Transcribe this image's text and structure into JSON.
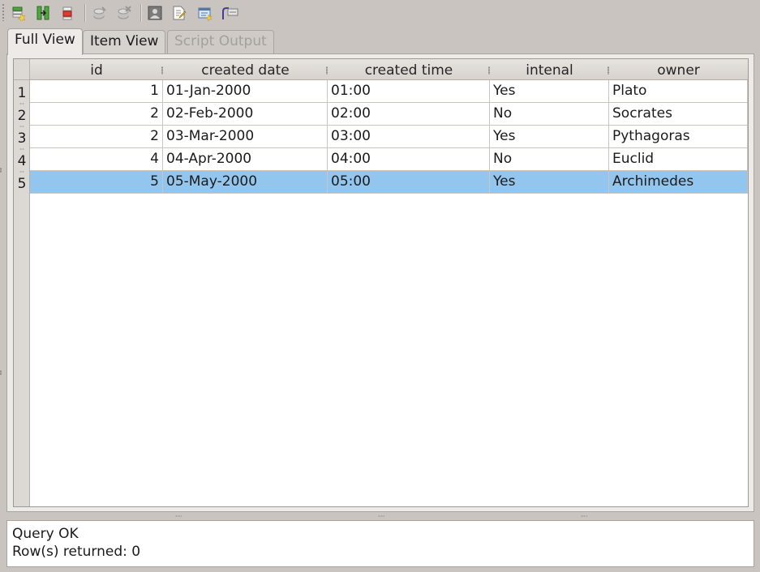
{
  "toolbar": {
    "items": [
      {
        "icon": "new-row-icon"
      },
      {
        "icon": "copy-row-icon"
      },
      {
        "icon": "delete-row-icon"
      },
      {
        "icon": "commit-icon"
      },
      {
        "icon": "rollback-icon"
      },
      {
        "icon": "image-icon"
      },
      {
        "icon": "export-icon"
      },
      {
        "icon": "sql-icon"
      },
      {
        "icon": "filter-icon"
      }
    ]
  },
  "tabs": [
    {
      "label": "Full View",
      "state": "active"
    },
    {
      "label": "Item View",
      "state": "normal"
    },
    {
      "label": "Script Output",
      "state": "disabled"
    }
  ],
  "table": {
    "columns": [
      "id",
      "created date",
      "created time",
      "intenal",
      "owner"
    ],
    "rows": [
      {
        "num": "1",
        "cells": [
          "1",
          "01-Jan-2000",
          "01:00",
          "Yes",
          "Plato"
        ]
      },
      {
        "num": "2",
        "cells": [
          "2",
          "02-Feb-2000",
          "02:00",
          "No",
          "Socrates"
        ]
      },
      {
        "num": "3",
        "cells": [
          "2",
          "03-Mar-2000",
          "03:00",
          "Yes",
          "Pythagoras"
        ]
      },
      {
        "num": "4",
        "cells": [
          "4",
          "04-Apr-2000",
          "04:00",
          "No",
          "Euclid"
        ]
      },
      {
        "num": "5",
        "cells": [
          "5",
          "05-May-2000",
          "05:00",
          "Yes",
          "Archimedes"
        ],
        "selected": true
      }
    ]
  },
  "status": {
    "line1": "Query OK",
    "line2": "Row(s) returned: 0"
  },
  "colors": {
    "selection": "#93c6ef",
    "window": "#c9c4c0"
  }
}
